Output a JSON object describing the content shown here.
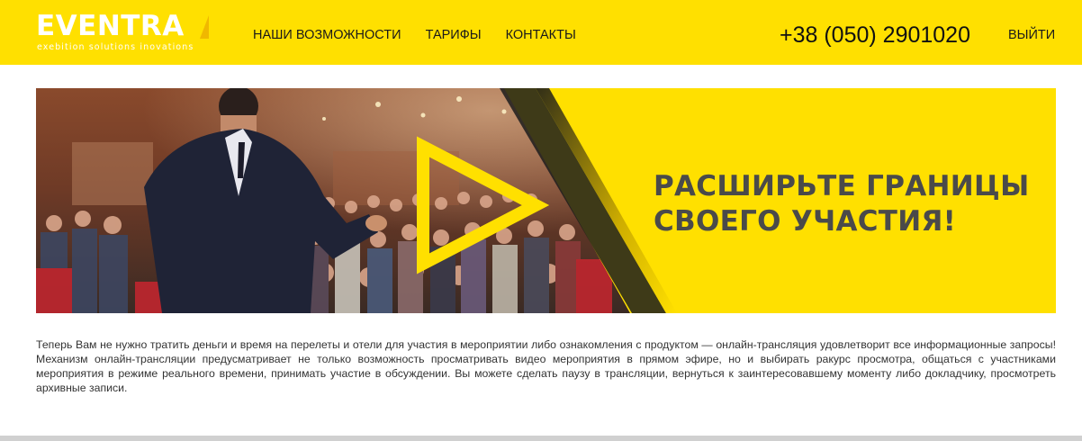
{
  "header": {
    "logo": {
      "word": "EVENTRA",
      "tagline": "exebition solutions inovations"
    },
    "nav": [
      {
        "label": "НАШИ ВОЗМОЖНОСТИ"
      },
      {
        "label": "ТАРИФЫ"
      },
      {
        "label": "КОНТАКТЫ"
      }
    ],
    "phone": "+38 (050) 2901020",
    "login": "ВЫЙТИ"
  },
  "banner": {
    "title_line1": "РАСШИРЬТЕ ГРАНИЦЫ",
    "title_line2": "СВОЕГО УЧАСТИЯ!",
    "image_alt": "play-icon"
  },
  "description": "Теперь Вам не нужно тратить деньги и время на перелеты и отели для участия в мероприятии либо ознакомления с продуктом — онлайн-трансляция удовлетворит все информационные запросы! Механизм онлайн-трансляции предусматривает не только возможность просматривать видео мероприятия в прямом эфире, но и выбирать ракурс просмотра, общаться с участниками мероприятия в режиме реального времени, принимать участие в обсуждении. Вы можете сделать паузу в трансляции, вернуться к заинтересовавшему моменту либо докладчику, просмотреть архивные записи.",
  "colors": {
    "brand_yellow": "#ffe000",
    "title_gray": "#4a4a4a"
  }
}
